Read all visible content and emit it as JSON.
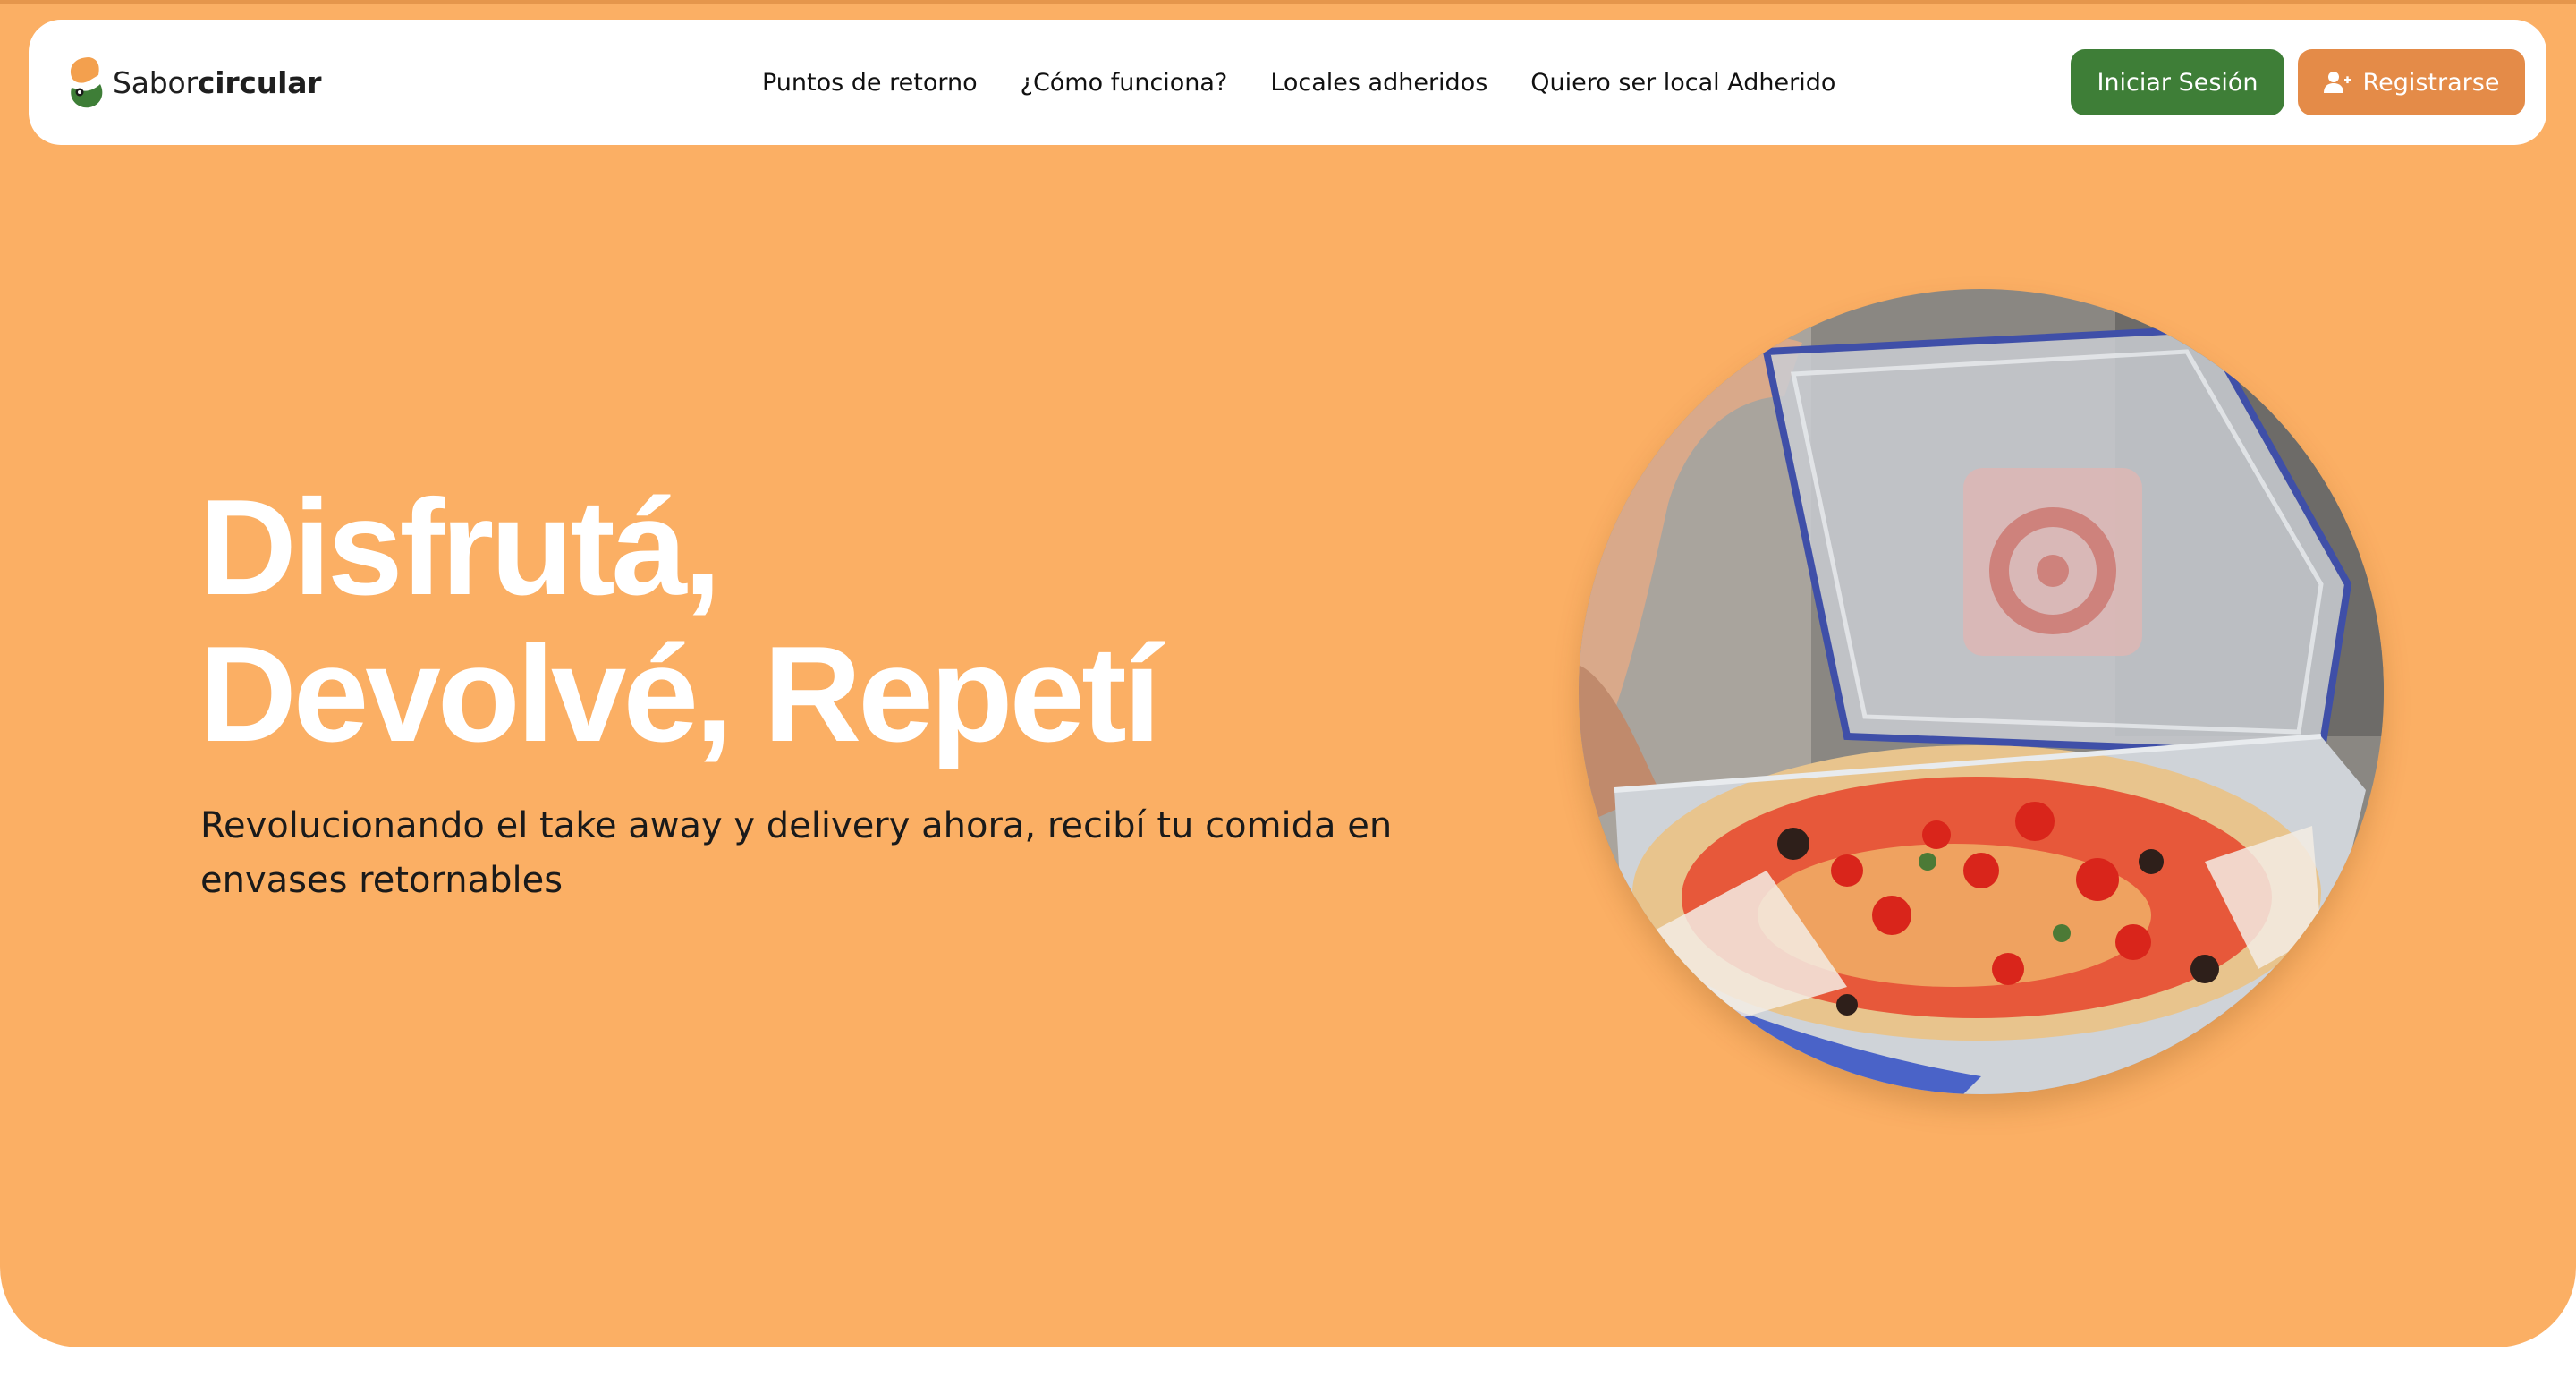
{
  "brand": {
    "name_part1": "Sabor",
    "name_part2": "circular",
    "logo_icon": "sabor-circular-logo",
    "colors": {
      "orange": "#f3a04e",
      "green": "#3e7e37"
    }
  },
  "nav": {
    "links": [
      {
        "label": "Puntos de retorno"
      },
      {
        "label": "¿Cómo funciona?"
      },
      {
        "label": "Locales adheridos"
      },
      {
        "label": "Quiero ser local Adherido"
      }
    ],
    "login_label": "Iniciar Sesión",
    "register_label": "Registrarse",
    "register_icon": "user-plus-icon"
  },
  "hero": {
    "title_line1": "Disfrutá,",
    "title_line2": "Devolvé, Repetí",
    "subtitle": "Revolucionando el take away y delivery ahora, recibí tu comida en envases retornables",
    "image_description_icon": "pizza-in-reusable-container-photo",
    "background_color": "#fbaf64"
  }
}
